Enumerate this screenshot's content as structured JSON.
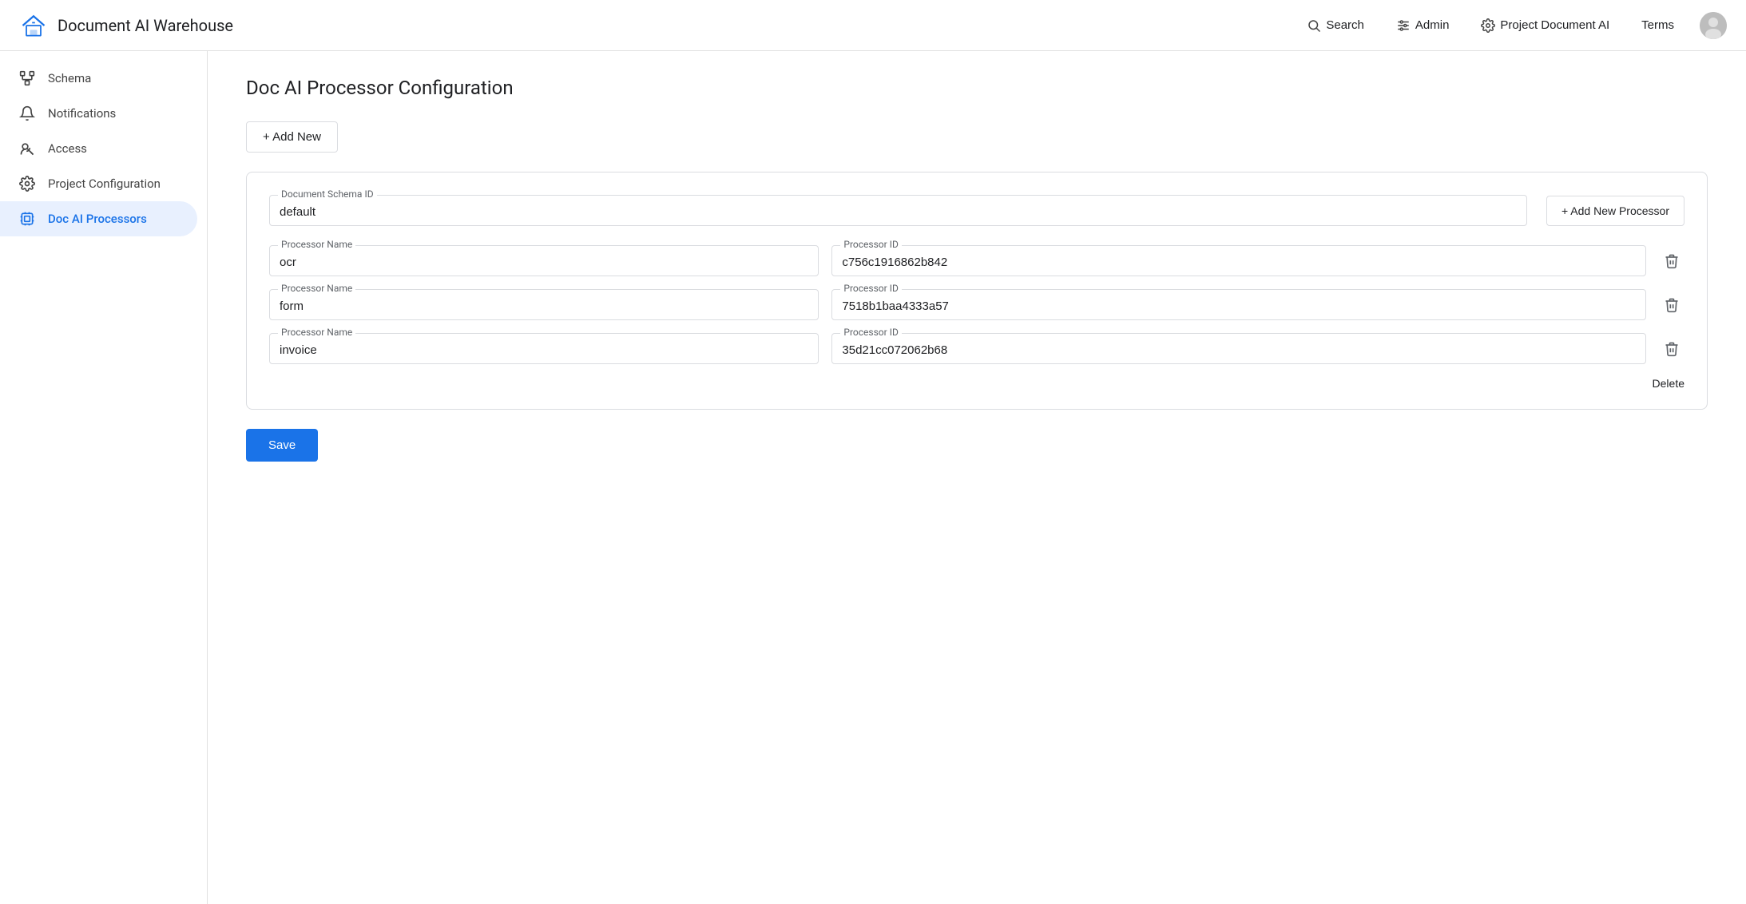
{
  "app": {
    "title": "Document AI Warehouse",
    "logo_alt": "Document AI Warehouse logo"
  },
  "topnav": {
    "search_label": "Search",
    "admin_label": "Admin",
    "project_label": "Project Document AI",
    "terms_label": "Terms"
  },
  "sidebar": {
    "items": [
      {
        "id": "schema",
        "label": "Schema",
        "icon": "schema-icon"
      },
      {
        "id": "notifications",
        "label": "Notifications",
        "icon": "bell-icon"
      },
      {
        "id": "access",
        "label": "Access",
        "icon": "access-icon"
      },
      {
        "id": "project-configuration",
        "label": "Project Configuration",
        "icon": "settings-icon"
      },
      {
        "id": "doc-ai-processors",
        "label": "Doc AI Processors",
        "icon": "processors-icon",
        "active": true
      }
    ]
  },
  "main": {
    "page_title": "Doc AI Processor Configuration",
    "add_new_label": "+ Add New",
    "save_label": "Save",
    "card": {
      "document_schema_id_label": "Document Schema ID",
      "document_schema_id_value": "default",
      "add_processor_label": "+ Add New Processor",
      "delete_label": "Delete",
      "processors": [
        {
          "name_label": "Processor Name",
          "name_value": "ocr",
          "id_label": "Processor ID",
          "id_value": "c756c1916862b842"
        },
        {
          "name_label": "Processor Name",
          "name_value": "form",
          "id_label": "Processor ID",
          "id_value": "7518b1baa4333a57"
        },
        {
          "name_label": "Processor Name",
          "name_value": "invoice",
          "id_label": "Processor ID",
          "id_value": "35d21cc072062b68"
        }
      ]
    }
  }
}
